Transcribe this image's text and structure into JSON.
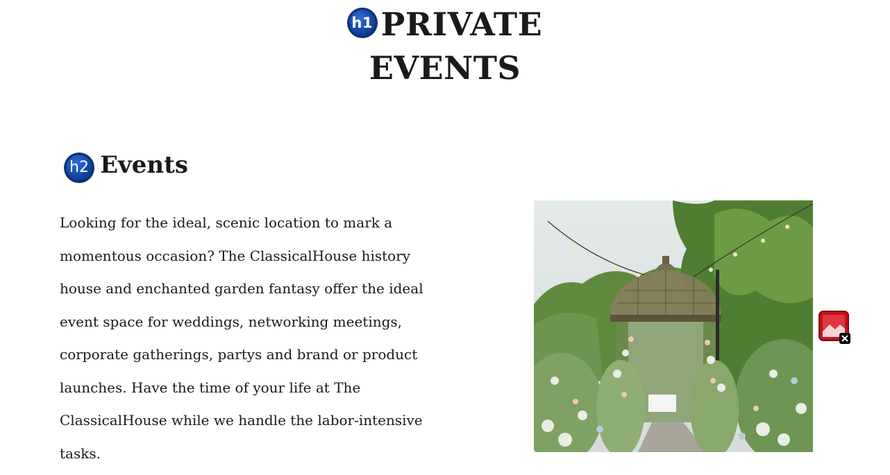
{
  "header": {
    "h1_badge": "h1",
    "title_line1": "PRIVATE",
    "title_line2": "EVENTS"
  },
  "section": {
    "h2_badge": "h2",
    "heading": "Events",
    "body": "Looking for the ideal, scenic location to mark a momentous occasion? The ClassicalHouse history house and enchanted garden fantasy offer the ideal event space for weddings, networking meetings, corporate gatherings, partys and brand or product launches. Have the time of your life at The ClassicalHouse while we handle the labor-intensive tasks."
  },
  "icons": {
    "heading_badges": "heading-level-badge",
    "broken": "broken-image-icon"
  },
  "colors": {
    "badge_blue": "#0f3f98",
    "broken_icon_red": "#c4111b",
    "text": "#1a1a1a"
  }
}
